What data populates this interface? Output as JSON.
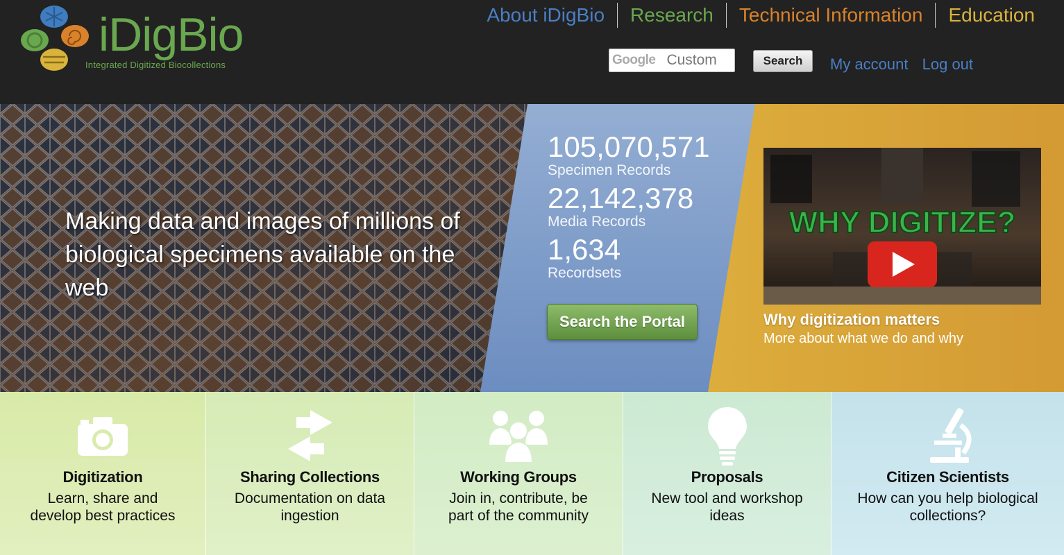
{
  "site": {
    "logo_text": "iDigBio",
    "logo_subtitle": "Integrated Digitized Biocollections"
  },
  "nav": {
    "items": [
      {
        "label": "About iDigBio",
        "color": "#4a7fc4"
      },
      {
        "label": "Research",
        "color": "#6aa84f"
      },
      {
        "label": "Technical Information",
        "color": "#d9822b"
      },
      {
        "label": "Education",
        "color": "#d9b33b"
      }
    ]
  },
  "search": {
    "google_mark": "Google",
    "placeholder": "Custom",
    "button_label": "Search"
  },
  "account": {
    "my_account": "My account",
    "logout": "Log out"
  },
  "hero": {
    "tagline": "Making data and images of millions of biological specimens available on the web",
    "stats": [
      {
        "value": "105,070,571",
        "label": "Specimen Records"
      },
      {
        "value": "22,142,378",
        "label": "Media Records"
      },
      {
        "value": "1,634",
        "label": "Recordsets"
      }
    ],
    "portal_button": "Search the Portal",
    "video_overlay": "WHY DIGITIZE?",
    "video_title": "Why digitization matters",
    "video_subtitle": "More about what we do and why"
  },
  "features": [
    {
      "title": "Digitization",
      "description": "Learn, share and develop best practices",
      "icon": "camera-icon"
    },
    {
      "title": "Sharing Collections",
      "description": "Documentation on data ingestion",
      "icon": "exchange-arrows-icon"
    },
    {
      "title": "Working Groups",
      "description": "Join in, contribute, be part of the community",
      "icon": "people-group-icon"
    },
    {
      "title": "Proposals",
      "description": "New tool and workshop ideas",
      "icon": "lightbulb-icon"
    },
    {
      "title": "Citizen Scientists",
      "description": "How can you help biological collections?",
      "icon": "microscope-icon"
    }
  ],
  "colors": {
    "header_bg": "#222222",
    "brand_green": "#6aa84f",
    "link_blue": "#4a7fc4",
    "stats_panel": "#7c9ccc",
    "video_panel": "#d8a83a"
  }
}
